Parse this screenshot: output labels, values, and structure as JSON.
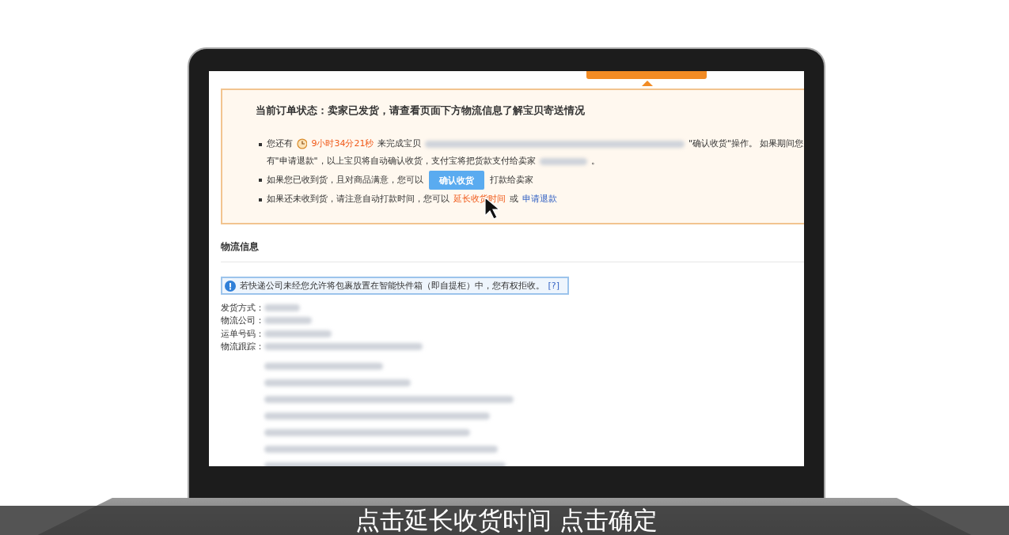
{
  "status_panel": {
    "title": "当前订单状态：卖家已发货，请查看页面下方物流信息了解宝贝寄送情况",
    "countdown_notice": {
      "before": "您还有",
      "time": "9小时34分21秒",
      "middle": "来完成宝贝",
      "after": "\"确认收货\"操作。 如果期间您",
      "continuation": "有\"申请退款\"，以上宝贝将自动确认收货，支付宝将把货款支付给卖家",
      "end": "。"
    },
    "confirm_notice": {
      "before": "如果您已收到货，且对商品满意，您可以",
      "button": "确认收货",
      "after": "打款给卖家"
    },
    "extend_notice": {
      "before": "如果还未收到货，请注意自动打款时间，您可以",
      "extend_link": "延长收货时间",
      "or": "或",
      "refund_link": "申请退款"
    }
  },
  "logistics": {
    "title": "物流信息",
    "tip": "若快递公司未经您允许将包裹放置在智能快件箱（即自提柜）中，您有权拒收。",
    "help_link": "[?]",
    "fields": [
      {
        "label": "发货方式："
      },
      {
        "label": "物流公司："
      },
      {
        "label": "运单号码："
      },
      {
        "label": "物流跟踪："
      }
    ]
  },
  "subtitle": "点击延长收货时间 点击确定"
}
